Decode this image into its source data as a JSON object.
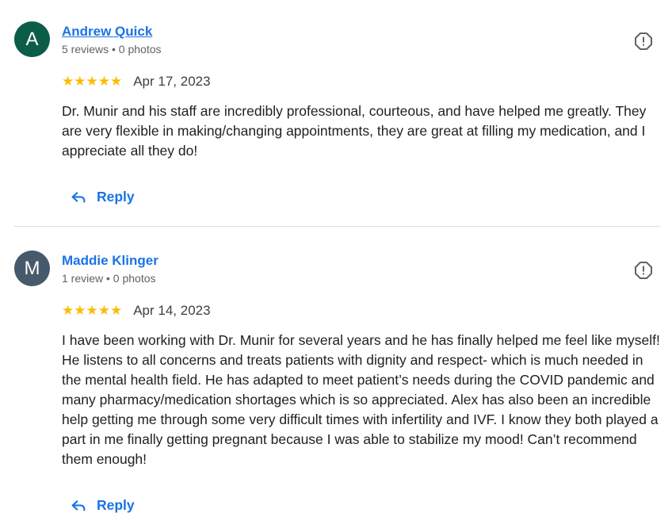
{
  "reviews": [
    {
      "avatar_letter": "A",
      "avatar_color": "#0b5d4a",
      "name": "Andrew Quick",
      "meta": "5 reviews • 0 photos",
      "stars": "★★★★★",
      "rating": 5,
      "date": "Apr 17, 2023",
      "text": "Dr. Munir and his staff are incredibly professional, courteous, and have helped me greatly. They are very flexible in making/changing appointments, they are great at filling my medication, and I appreciate all they do!",
      "reply_label": "Reply"
    },
    {
      "avatar_letter": "M",
      "avatar_color": "#475a6b",
      "name": "Maddie Klinger",
      "meta": "1 review • 0 photos",
      "stars": "★★★★★",
      "rating": 5,
      "date": "Apr 14, 2023",
      "text": "I have been working with Dr. Munir for several years and he has finally helped me feel like myself! He listens to all concerns and treats patients with dignity and respect- which is much needed in the mental health field. He has adapted to meet patient’s needs during the COVID pandemic and many pharmacy/medication shortages which is so appreciated. Alex has also been an incredible help getting me through some very difficult times with infertility and IVF. I know they both played a part in me finally getting pregnant because I was able to stabilize my mood! Can’t recommend them enough!",
      "reply_label": "Reply"
    }
  ],
  "colors": {
    "link": "#1a73e8",
    "star": "#fbbc04",
    "divider": "#dadce0"
  },
  "icons": {
    "report": "report-icon",
    "reply": "reply-icon"
  }
}
